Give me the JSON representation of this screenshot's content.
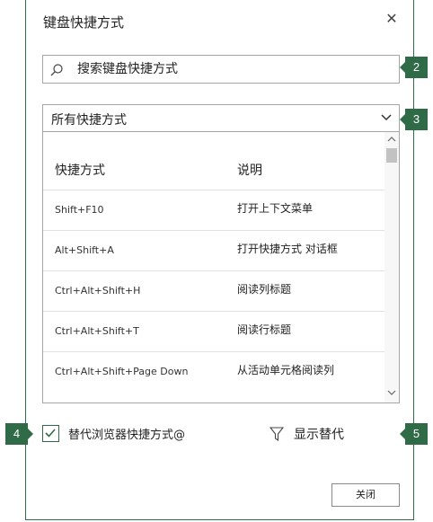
{
  "dialog": {
    "title": "键盘快捷方式",
    "close_icon": "close-icon"
  },
  "search": {
    "placeholder": "搜索键盘快捷方式",
    "icon": "search-icon"
  },
  "filter_dropdown": {
    "selected": "所有快捷方式"
  },
  "table": {
    "headers": [
      "快捷方式",
      "说明"
    ],
    "rows": [
      {
        "keys": "Shift+F10",
        "desc": "打开上下文菜单"
      },
      {
        "keys": "Alt+Shift+A",
        "desc": "打开快捷方式 对话框"
      },
      {
        "keys": "Ctrl+Alt+Shift+H",
        "desc": "阅读列标题"
      },
      {
        "keys": "Ctrl+Alt+Shift+T",
        "desc": "阅读行标题"
      },
      {
        "keys": "Ctrl+Alt+Shift+Page Down",
        "desc": "从活动单元格阅读列"
      }
    ]
  },
  "override": {
    "label": "替代浏览器快捷方式@",
    "checked": true
  },
  "show_overrides": {
    "label": "显示替代",
    "icon": "filter-icon"
  },
  "footer": {
    "close_label": "关闭"
  },
  "callouts": [
    "2",
    "3",
    "4",
    "5"
  ],
  "colors": {
    "accent": "#2f6b46",
    "border": "#a6a6a6"
  }
}
